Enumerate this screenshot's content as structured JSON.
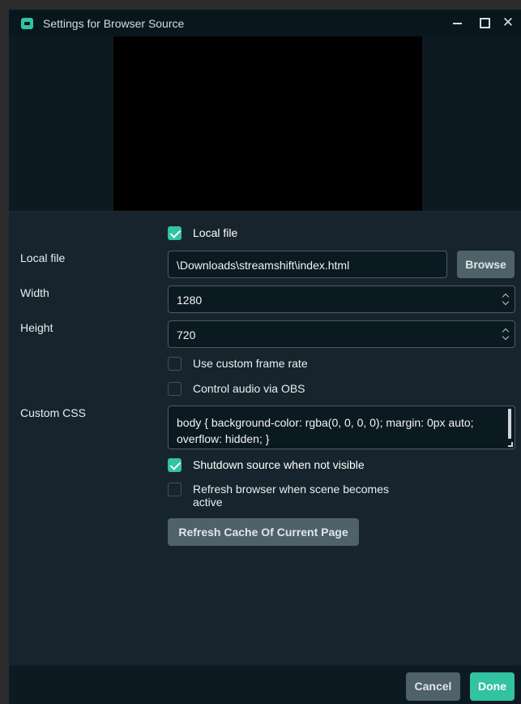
{
  "window": {
    "title": "Settings for Browser Source",
    "close_glyph": "✕"
  },
  "form": {
    "local_file_checkbox": {
      "label": "Local file",
      "checked": true
    },
    "local_file": {
      "label": "Local file",
      "value": "\\Downloads\\streamshift\\index.html",
      "browse_label": "Browse"
    },
    "width": {
      "label": "Width",
      "value": "1280"
    },
    "height": {
      "label": "Height",
      "value": "720"
    },
    "custom_frame_rate": {
      "label": "Use custom frame rate",
      "checked": false
    },
    "control_audio": {
      "label": "Control audio via OBS",
      "checked": false
    },
    "custom_css": {
      "label": "Custom CSS",
      "value": "body { background-color: rgba(0, 0, 0, 0); margin: 0px auto; overflow: hidden; }"
    },
    "shutdown_source": {
      "label": "Shutdown source when not visible",
      "checked": true
    },
    "refresh_browser": {
      "label": "Refresh browser when scene becomes active",
      "checked": false
    },
    "refresh_cache_label": "Refresh Cache Of Current Page"
  },
  "footer": {
    "cancel_label": "Cancel",
    "done_label": "Done"
  },
  "colors": {
    "accent": "#31c3a2",
    "background": "#17242d",
    "field_bg": "#0b1a21",
    "button_gray": "#4f6169"
  }
}
